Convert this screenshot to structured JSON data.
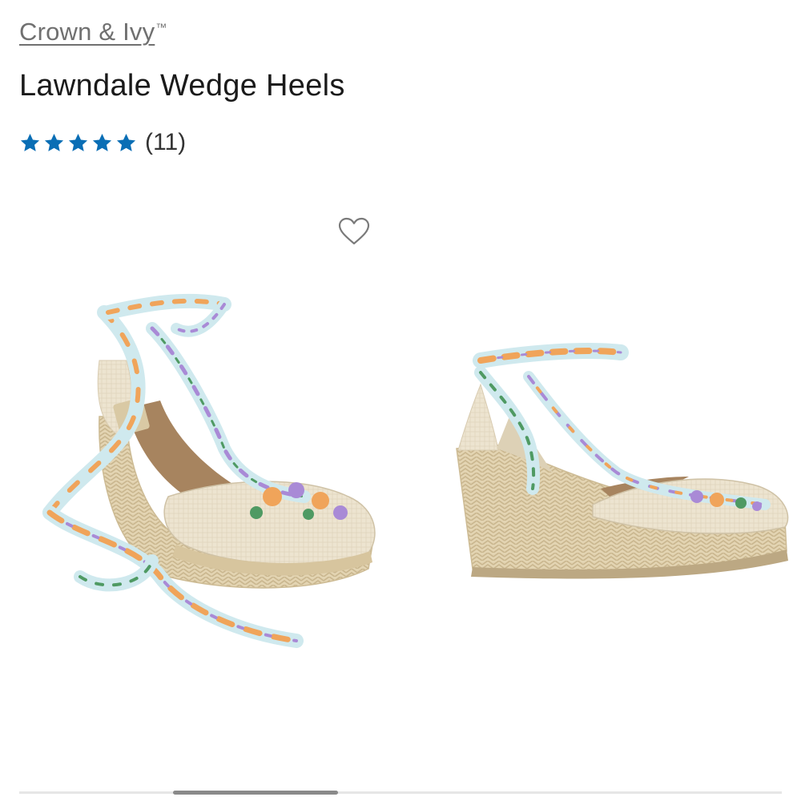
{
  "product": {
    "brand": "Crown & Ivy",
    "brand_mark": "™",
    "title": "Lawndale Wedge Heels",
    "rating": {
      "stars": 5,
      "max_stars": 5,
      "review_count": "(11)"
    }
  },
  "colors": {
    "star": "#0a6eb5",
    "brand_text": "#707070",
    "title_text": "#1a1a1a",
    "canvas_fabric": "#ece3cf",
    "jute_sole": "#e2d3b0",
    "ribbon_base": "#cfe9ee",
    "ribbon_orange": "#f0a45a",
    "ribbon_purple": "#a98ad6",
    "ribbon_green": "#4f9a63"
  },
  "icons": {
    "favorite": "heart-outline-icon",
    "rating": "star-icon"
  }
}
